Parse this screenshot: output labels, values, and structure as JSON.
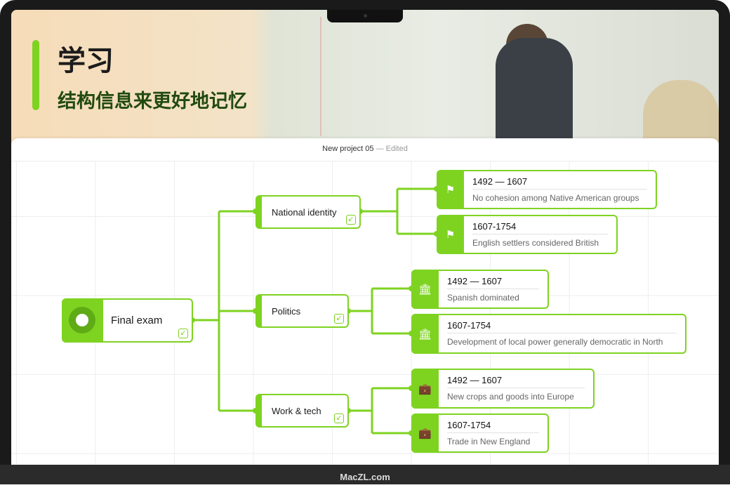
{
  "banner": {
    "title": "学习",
    "subtitle": "结构信息来更好地记忆"
  },
  "window": {
    "project": "New project 05",
    "status": "— Edited"
  },
  "mindmap": {
    "accent": "#7ed321",
    "root": {
      "label": "Final exam",
      "icon": "target-icon"
    },
    "branches": [
      {
        "label": "National identity",
        "icon": "flag-icon",
        "children": [
          {
            "period": "1492 — 1607",
            "text": "No cohesion among Native American groups"
          },
          {
            "period": "1607-1754",
            "text": "English settlers considered British"
          }
        ]
      },
      {
        "label": "Politics",
        "icon": "bank-icon",
        "children": [
          {
            "period": "1492 — 1607",
            "text": "Spanish dominated"
          },
          {
            "period": "1607-1754",
            "text": "Development of local power generally democratic in North"
          }
        ]
      },
      {
        "label": "Work & tech",
        "icon": "briefcase-icon",
        "children": [
          {
            "period": "1492 — 1607",
            "text": "New crops and goods into Europe"
          },
          {
            "period": "1607-1754",
            "text": "Trade in New England"
          }
        ]
      }
    ]
  },
  "footer": {
    "watermark": "MacZL.com"
  }
}
